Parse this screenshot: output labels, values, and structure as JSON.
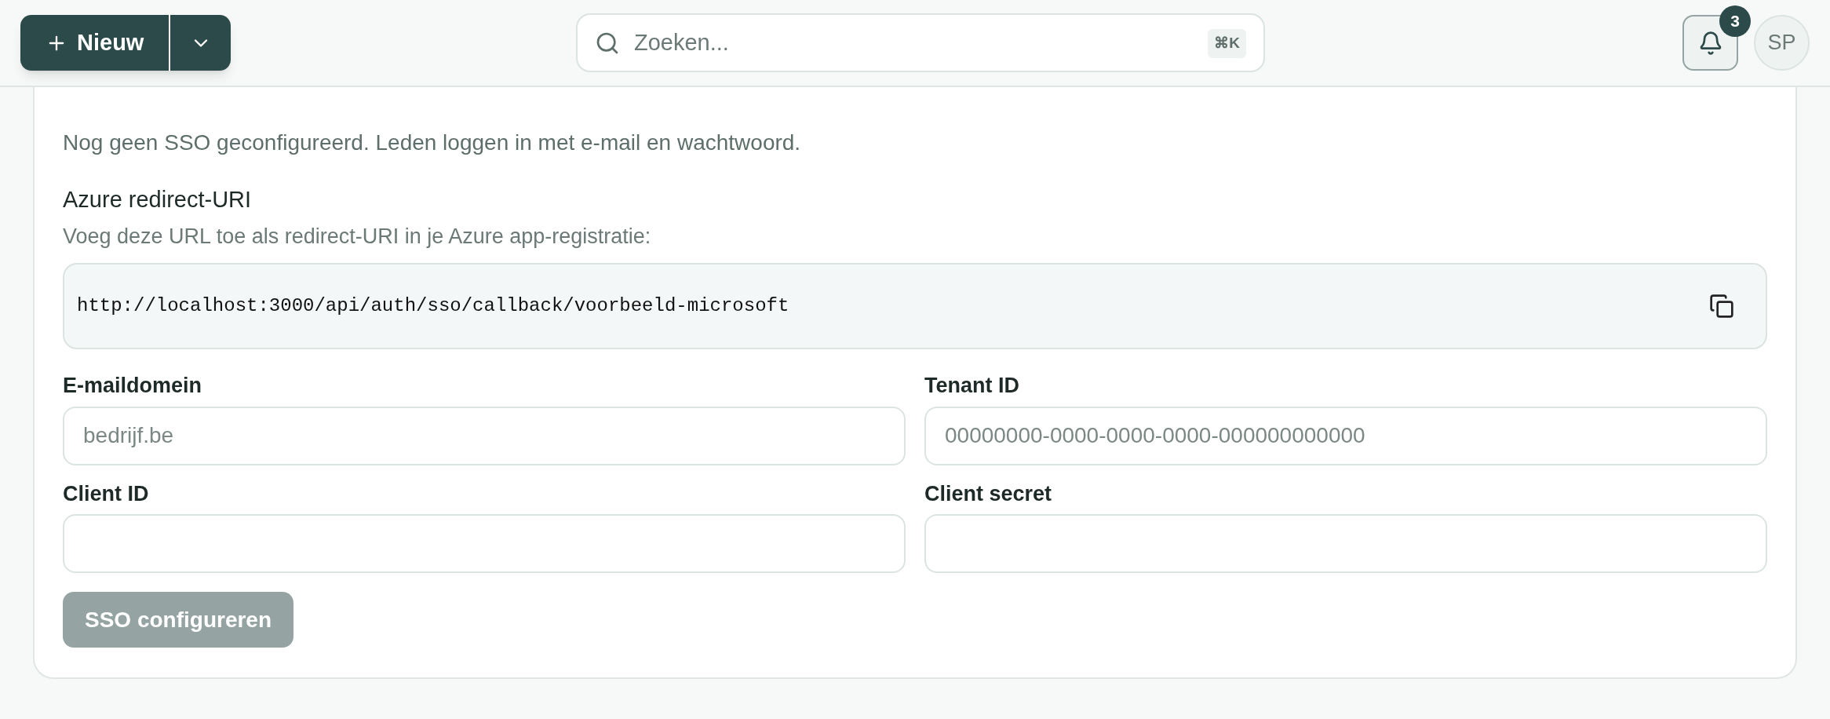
{
  "header": {
    "new_button": {
      "label": "Nieuw"
    },
    "search": {
      "placeholder": "Zoeken...",
      "shortcut": "⌘K"
    },
    "notifications": {
      "count": "3"
    },
    "avatar": {
      "initials": "SP"
    }
  },
  "sso": {
    "status": "Nog geen SSO geconfigureerd. Leden loggen in met e-mail en wachtwoord.",
    "redirect": {
      "title": "Azure redirect-URI",
      "description": "Voeg deze URL toe als redirect-URI in je Azure app-registratie:",
      "url": "http://localhost:3000/api/auth/sso/callback/voorbeeld-microsoft"
    },
    "fields": [
      {
        "label": "E-maildomein",
        "placeholder": "bedrijf.be"
      },
      {
        "label": "Tenant ID",
        "placeholder": "00000000-0000-0000-0000-000000000000"
      },
      {
        "label": "Client ID"
      },
      {
        "label": "Client secret"
      }
    ],
    "submit": {
      "label": "SSO configureren",
      "disabled": true
    }
  }
}
